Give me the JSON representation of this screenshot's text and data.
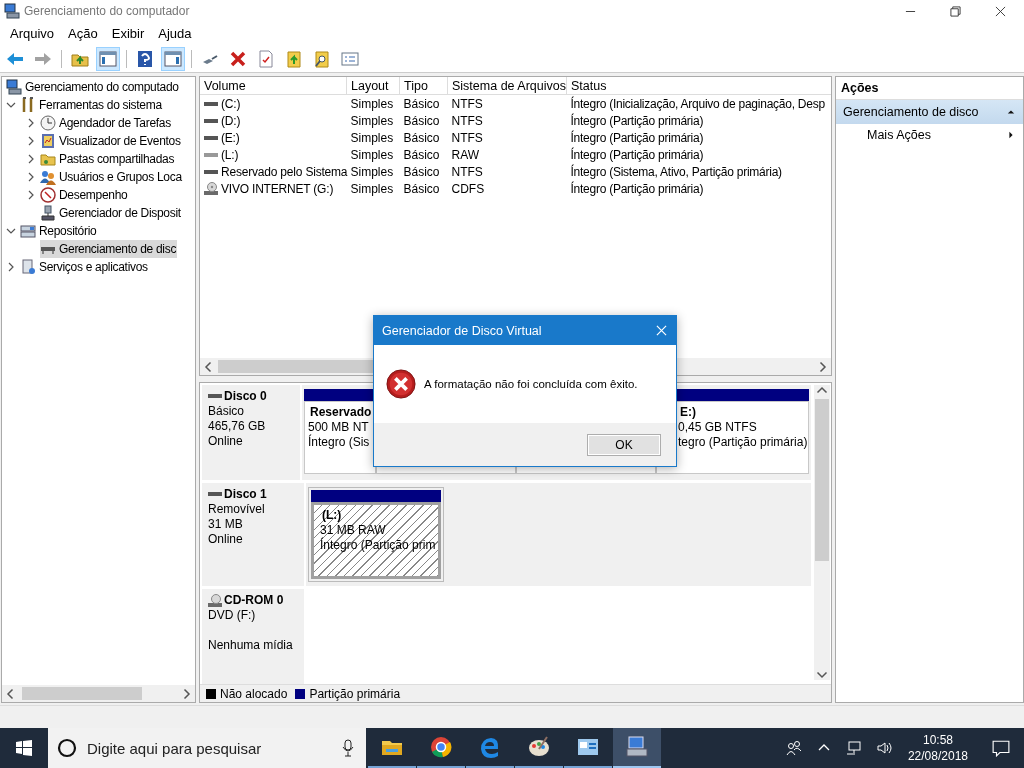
{
  "window": {
    "title": "Gerenciamento do computador"
  },
  "menu": [
    "Arquivo",
    "Ação",
    "Exibir",
    "Ajuda"
  ],
  "toolbar": [
    {
      "kind": "back",
      "disabled": false,
      "on": false
    },
    {
      "kind": "forward",
      "disabled": true,
      "on": false
    },
    {
      "kind": "separator"
    },
    {
      "kind": "up",
      "disabled": false,
      "on": false
    },
    {
      "kind": "tree",
      "disabled": false,
      "on": true
    },
    {
      "kind": "separator"
    },
    {
      "kind": "help",
      "disabled": false,
      "on": false
    },
    {
      "kind": "actions",
      "disabled": false,
      "on": true
    },
    {
      "kind": "separator"
    },
    {
      "kind": "connect",
      "disabled": false,
      "on": false
    },
    {
      "kind": "delete",
      "disabled": false,
      "on": false
    },
    {
      "kind": "properties",
      "disabled": false,
      "on": false
    },
    {
      "kind": "export",
      "disabled": false,
      "on": false
    },
    {
      "kind": "find",
      "disabled": false,
      "on": false
    },
    {
      "kind": "list",
      "disabled": false,
      "on": false
    }
  ],
  "tree": [
    {
      "label": "Gerenciamento do computado",
      "kind": "computer",
      "selected": false,
      "children": [
        {
          "label": "Ferramentas do sistema",
          "kind": "tools",
          "expanded": true,
          "selected": false,
          "children": [
            {
              "label": "Agendador de Tarefas",
              "kind": "clock",
              "expanded": false,
              "selected": false
            },
            {
              "label": "Visualizador de Eventos",
              "kind": "log",
              "expanded": false,
              "selected": false
            },
            {
              "label": "Pastas compartilhadas",
              "kind": "share",
              "expanded": false,
              "selected": false
            },
            {
              "label": "Usuários e Grupos Loca",
              "kind": "users",
              "expanded": false,
              "selected": false
            },
            {
              "label": "Desempenho",
              "kind": "gauge",
              "expanded": false,
              "selected": false
            },
            {
              "label": "Gerenciador de Disposit",
              "kind": "device",
              "selected": false
            }
          ]
        },
        {
          "label": "Repositório",
          "kind": "storage",
          "expanded": true,
          "selected": false,
          "children": [
            {
              "label": "Gerenciamento de disc",
              "kind": "drive",
              "selected": true
            }
          ]
        },
        {
          "label": "Serviços e aplicativos",
          "kind": "services",
          "expanded": false,
          "selected": false
        }
      ]
    }
  ],
  "volumes": {
    "columns": [
      "Volume",
      "Layout",
      "Tipo",
      "Sistema de Arquivos",
      "Status"
    ],
    "rows": [
      {
        "kind": "disk",
        "volume": "(C:)",
        "layout": "Simples",
        "type": "Básico",
        "fs": "NTFS",
        "status": "Íntegro (Inicialização, Arquivo de paginação, Desp"
      },
      {
        "kind": "disk",
        "volume": "(D:)",
        "layout": "Simples",
        "type": "Básico",
        "fs": "NTFS",
        "status": "Íntegro (Partição primária)"
      },
      {
        "kind": "disk",
        "volume": "(E:)",
        "layout": "Simples",
        "type": "Básico",
        "fs": "NTFS",
        "status": "Íntegro (Partição primária)"
      },
      {
        "kind": "removable",
        "volume": "(L:)",
        "layout": "Simples",
        "type": "Básico",
        "fs": "RAW",
        "status": "Íntegro (Partição primária)"
      },
      {
        "kind": "disk",
        "volume": "Reservado pelo Sistema",
        "layout": "Simples",
        "type": "Básico",
        "fs": "NTFS",
        "status": "Íntegro (Sistema, Ativo, Partição primária)"
      },
      {
        "kind": "cd",
        "volume": "VIVO INTERNET (G:)",
        "layout": "Simples",
        "type": "Básico",
        "fs": "CDFS",
        "status": "Íntegro (Partição primária)"
      }
    ]
  },
  "disks": [
    {
      "kind": "disk",
      "name": "Disco 0",
      "type": "Básico",
      "size": "465,76 GB",
      "status": "Online",
      "partitions": [
        {
          "title": "Reservado",
          "size": "500 MB NT",
          "status": "Íntegro (Sis",
          "selected": false
        },
        {
          "selected": false
        },
        {
          "selected": false
        },
        {
          "title": "E:)",
          "size": "0,45 GB NTFS",
          "status": "tegro (Partição primária)",
          "selected": false
        }
      ]
    },
    {
      "kind": "disk",
      "name": "Disco 1",
      "type": "Removível",
      "size": "31 MB",
      "status": "Online",
      "partitions": [
        {
          "title": "(L:)",
          "size": "31 MB RAW",
          "status": "Íntegro (Partição prim",
          "selected": true
        }
      ]
    },
    {
      "kind": "cdrom",
      "name": "CD-ROM 0",
      "type": "DVD (F:)",
      "status": "Nenhuma mídia"
    }
  ],
  "legend": [
    {
      "label": "Não alocado",
      "color": "#000000"
    },
    {
      "label": "Partição primária",
      "color": "#000080"
    }
  ],
  "actions": {
    "title": "Ações",
    "section": "Gerenciamento de disco",
    "expanded": true,
    "items": [
      "Mais Ações"
    ]
  },
  "dialog": {
    "title": "Gerenciador de Disco Virtual",
    "message": "A formatação não foi concluída com êxito.",
    "button": "OK"
  },
  "taskbar": {
    "search_placeholder": "Digite aqui para pesquisar",
    "apps": [
      {
        "kind": "explorer",
        "selected": false
      },
      {
        "kind": "chrome",
        "selected": false
      },
      {
        "kind": "edge",
        "selected": false
      },
      {
        "kind": "paint",
        "selected": false
      },
      {
        "kind": "control",
        "selected": false
      },
      {
        "kind": "computer",
        "selected": true
      }
    ],
    "time": "10:58",
    "date": "22/08/2018"
  }
}
